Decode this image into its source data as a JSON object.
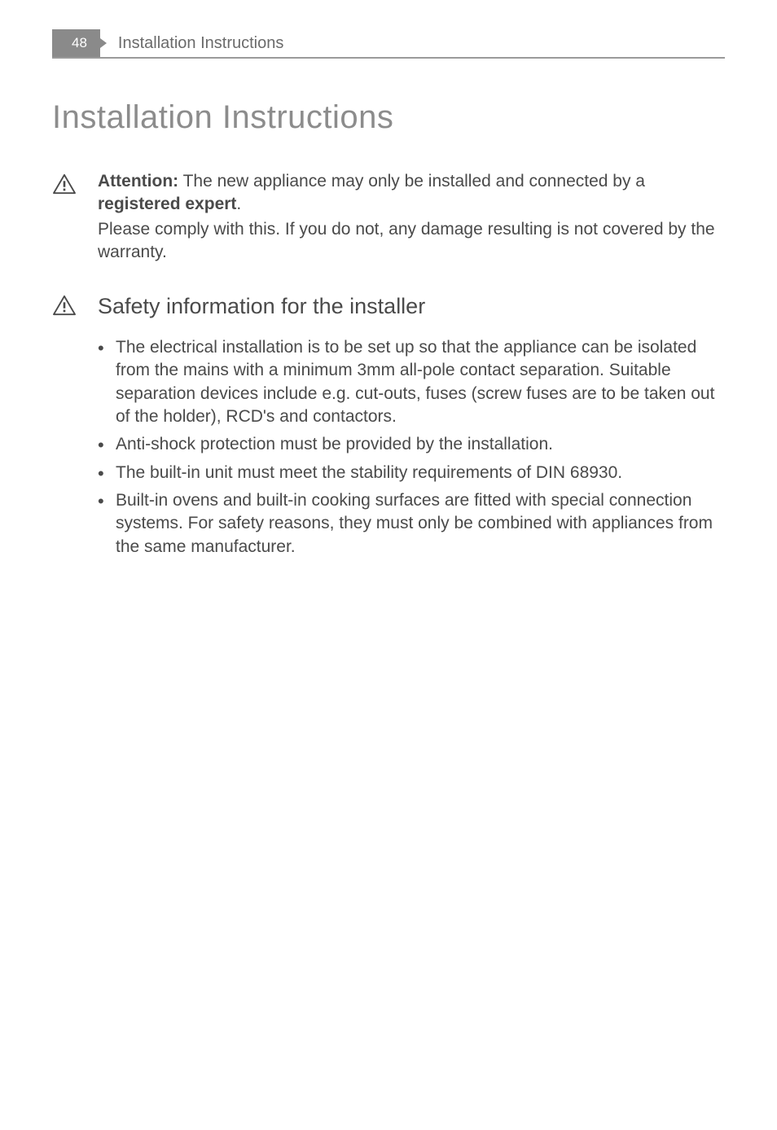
{
  "header": {
    "page_number": "48",
    "running_title": "Installation Instructions"
  },
  "main_heading": "Installation Instructions",
  "attention_block": {
    "label": "Attention:",
    "text_before_bold": " The new appliance may only be installed and connected by a ",
    "bold_term": "registered expert",
    "text_after_bold": ".",
    "para2": "Please comply with this. If you do not, any damage resulting is not covered by the warranty."
  },
  "safety_section": {
    "heading": "Safety information for the installer",
    "bullets": [
      "The electrical installation is to be set up so that the appliance can be isolated from the mains with a minimum 3mm all-pole contact separation. Suitable separation devices include e.g. cut-outs, fuses (screw fuses are to be taken out of the holder), RCD's and contactors.",
      "Anti-shock protection must be provided by the installation.",
      "The built-in unit must meet the stability requirements of DIN 68930.",
      "Built-in ovens and built-in cooking surfaces are fitted with special connection systems. For safety reasons, they must only be combined with appliances from the same manufacturer."
    ]
  }
}
